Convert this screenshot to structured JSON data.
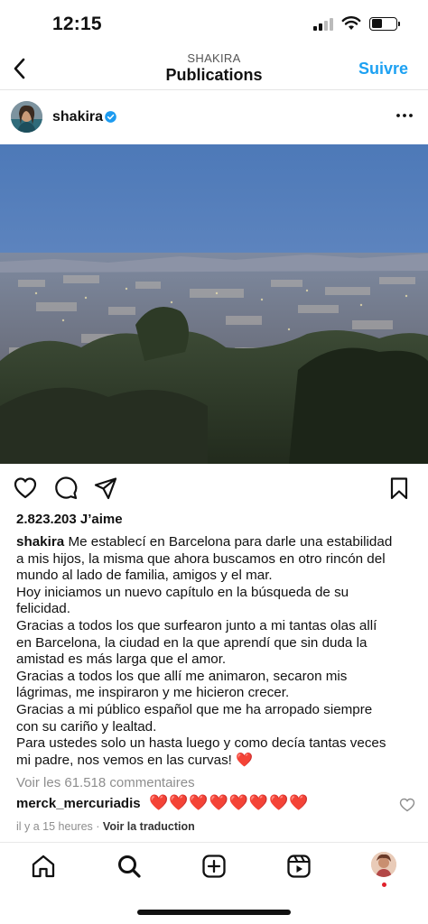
{
  "status": {
    "time": "12:15"
  },
  "header": {
    "subtitle": "SHAKIRA",
    "title": "Publications",
    "follow_label": "Suivre"
  },
  "post": {
    "username": "shakira",
    "likes": "2.823.203 J’aime",
    "caption_username": "shakira",
    "caption_lines": [
      "Me establecí en Barcelona para darle una estabilidad",
      "a mis hijos, la misma que ahora buscamos en otro rincón del",
      "mundo al lado de familia, amigos y el mar.",
      "Hoy iniciamos un nuevo capítulo en la búsqueda de su",
      "felicidad.",
      "Gracias a todos los que surfearon junto a mi tantas olas allí",
      "en Barcelona, la ciudad en la que aprendí que sin duda la",
      "amistad  es más larga que el amor.",
      "Gracias a todos los que allí me animaron, secaron mis",
      "lágrimas, me inspiraron y me hicieron crecer.",
      "Gracias a mi público español que me ha arropado siempre",
      "con su cariño y lealtad.",
      "Para ustedes solo un hasta luego y como decía tantas veces",
      "mi padre, nos vemos en las curvas! ❤️"
    ],
    "view_comments": "Voir les 61.518 commentaires",
    "top_comment": {
      "username": "merck_mercuriadis",
      "text": "❤️❤️❤️❤️❤️❤️❤️❤️"
    },
    "time_ago": "il y a 15 heures",
    "separator": "·",
    "translate": "Voir la traduction"
  },
  "icons": {
    "back": "chevron-left-icon",
    "verified": "verified-badge-icon",
    "more": "more-horizontal-icon",
    "like": "heart-icon",
    "comment": "comment-icon",
    "share": "send-icon",
    "save": "bookmark-icon",
    "tabs": [
      "home-icon",
      "search-icon",
      "create-icon",
      "reels-icon",
      "profile-avatar"
    ]
  },
  "colors": {
    "accent": "#1da1f2",
    "heart": "#e0212b",
    "muted": "#8e8e8e"
  }
}
